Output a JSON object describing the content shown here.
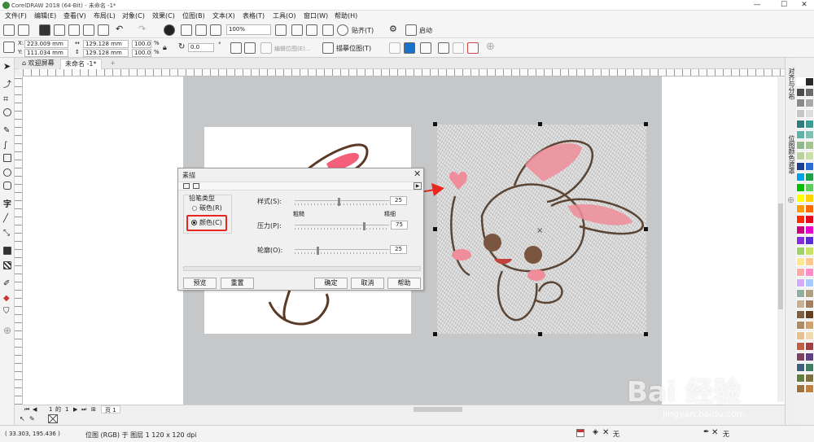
{
  "window": {
    "title": "CorelDRAW 2018 (64-Bit) - 未命名 -1*",
    "minimize": "—",
    "maximize": "☐",
    "close": "✕"
  },
  "menus": [
    "文件(F)",
    "编辑(E)",
    "查看(V)",
    "布局(L)",
    "对象(C)",
    "效果(C)",
    "位图(B)",
    "文本(X)",
    "表格(T)",
    "工具(O)",
    "窗口(W)",
    "帮助(H)"
  ],
  "toolbar1": {
    "zoom": "100%",
    "snap_label": "贴齐(T)",
    "launch_label": "启动"
  },
  "toolbar2": {
    "x": "223.009 mm",
    "y": "111.034 mm",
    "width": "129.128 mm",
    "height": "129.128 mm",
    "scale_w": "100.0",
    "scale_h": "100.0",
    "percent": "%",
    "angle": "0.0",
    "degree": "°",
    "edit_bitmap": "编辑位图(E)...",
    "trace_bitmap": "描摹位图(T)"
  },
  "tabs": [
    {
      "label": "欢迎屏幕"
    },
    {
      "label": "未命名 -1*"
    }
  ],
  "dialog": {
    "title": "素描",
    "group_label": "铅笔类型",
    "option_carbon": "碳色(R)",
    "option_color": "颜色(C)",
    "style_label": "样式(S):",
    "style_value": "25",
    "coarse_label": "粗糙",
    "fine_label": "精细",
    "pressure_label": "压力(P):",
    "pressure_value": "75",
    "outline_label": "轮廓(O):",
    "outline_value": "25",
    "preview_btn": "预览",
    "reset_btn": "重置",
    "ok_btn": "确定",
    "cancel_btn": "取消",
    "help_btn": "帮助"
  },
  "docker_tabs": [
    "对齐与分布",
    "位图颜色遮罩"
  ],
  "page_nav": {
    "current": "1",
    "of": "的",
    "total": "1",
    "page_tab": "页 1"
  },
  "status": {
    "coords": "( 33.303, 195.436 )",
    "object_info": "位图 (RGB) 于 图层 1 120 x 120 dpi",
    "fill_none": "无",
    "outline_none": "无"
  },
  "watermark": {
    "brand": "Bai 经验",
    "url": "jingyan.baidu.com"
  },
  "colors": {
    "accent_red": "#e8281e",
    "selection": "#d81e06",
    "page_gray": "#c6c7c8",
    "bunny_pink": "#f08d9a"
  },
  "palette": [
    "#ffffff",
    "#2a2a2a",
    "#4d4d4d",
    "#6b6b6b",
    "#8a8a8a",
    "#a8a8a8",
    "#c6c6c6",
    "#dddddd",
    "#2e7d7a",
    "#3e9c96",
    "#5fb4a9",
    "#7ec1b2",
    "#8fb78a",
    "#a4c490",
    "#b9d19a",
    "#cadfa6",
    "#1c3f94",
    "#2b6bd6",
    "#00a2e8",
    "#1aa34a",
    "#00c000",
    "#5ad05a",
    "#ffff00",
    "#ffd200",
    "#ff9c00",
    "#ff6a00",
    "#ff2a00",
    "#e6001e",
    "#c8007a",
    "#e600c8",
    "#8a2be2",
    "#5b2bd6",
    "#9fd36a",
    "#c8e36a",
    "#ffe690",
    "#ffc890",
    "#ffa8a8",
    "#ff8cc8",
    "#d8a8ff",
    "#a8c8ff",
    "#8fb0a0",
    "#b0a080",
    "#c8b090",
    "#a08060",
    "#806040",
    "#604020",
    "#b08a60",
    "#d0a070",
    "#e8c090",
    "#f0d8b0",
    "#c06040",
    "#a04040",
    "#804060",
    "#604080",
    "#406080",
    "#408060",
    "#608040",
    "#807040",
    "#a07040",
    "#c08040"
  ]
}
